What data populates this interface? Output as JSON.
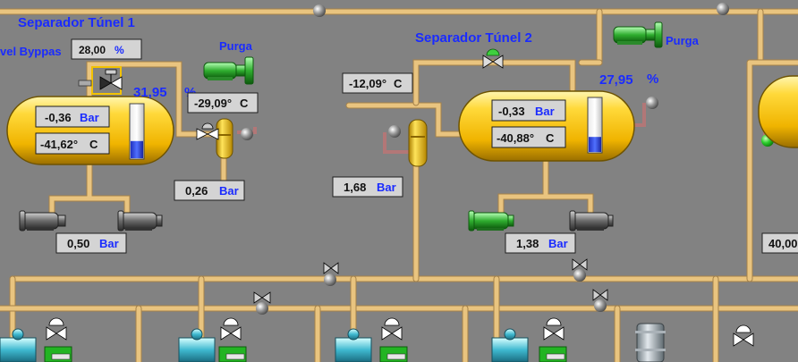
{
  "separator1": {
    "title": "Separador Túnel 1",
    "level_bypass_label": "vel Byppas",
    "level_bypass": {
      "value": "28,00",
      "unit": "%"
    },
    "level": {
      "value": "31,95",
      "unit": "%"
    },
    "pressure": {
      "value": "-0,36",
      "unit": "Bar"
    },
    "temperature": {
      "value": "-41,62°",
      "unit": "C"
    },
    "purge_label": "Purga",
    "purge_temperature": {
      "value": "-29,09°",
      "unit": "C"
    },
    "trap_pressure": {
      "value": "0,26",
      "unit": "Bar"
    },
    "pump_pressure": {
      "value": "0,50",
      "unit": "Bar"
    },
    "level_fill": 0.32
  },
  "separator2": {
    "title": "Separador Túnel 2",
    "level": {
      "value": "27,95",
      "unit": "%"
    },
    "pressure": {
      "value": "-0,33",
      "unit": "Bar"
    },
    "temperature": {
      "value": "-40,88°",
      "unit": "C"
    },
    "purge_label": "Purga",
    "inlet_temperature": {
      "value": "-12,09°",
      "unit": "C"
    },
    "trap_pressure": {
      "value": "1,68",
      "unit": "Bar"
    },
    "pump_pressure": {
      "value": "1,38",
      "unit": "Bar"
    },
    "level_fill": 0.28
  },
  "separator3": {
    "pump_pressure": {
      "value": "40,00",
      "unit": ""
    }
  },
  "colors": {
    "background": "#828282",
    "pipe": "#e9c47f",
    "vessel": "#f5c400",
    "label_blue": "#1a2bff",
    "pump_active": "#33cc33",
    "pump_idle": "#444444"
  },
  "icons": [
    "separator-vessel",
    "valve-icon",
    "pump-icon",
    "purge-icon",
    "compressor-icon"
  ]
}
